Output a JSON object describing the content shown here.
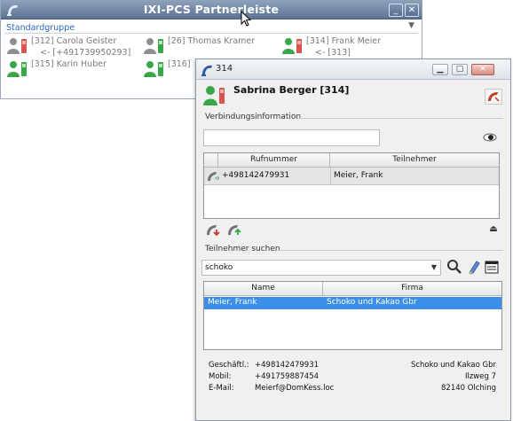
{
  "back_window": {
    "title": "IXI-PCS Partnerleiste",
    "group": "Standardgruppe",
    "partners": [
      {
        "name": "[312] Carola Geister",
        "number": "<- [+491739950293]"
      },
      {
        "name": "[26] Thomas Kramer",
        "number": ""
      },
      {
        "name": "[314] Frank Meier",
        "number": "<- [313]"
      },
      {
        "name": "[315] Karin Huber",
        "number": ""
      },
      {
        "name": "[316]",
        "number": ""
      }
    ]
  },
  "front_window": {
    "title": "314",
    "caller": "Sabrina Berger  [314]",
    "connection": {
      "section_label": "Verbindungsinformation",
      "input_value": "",
      "columns": [
        "Rufnummer",
        "Teilnehmer"
      ],
      "rows": [
        {
          "number": "+498142479931",
          "participant": "Meier, Frank"
        }
      ]
    },
    "search": {
      "section_label": "Teilnehmer suchen",
      "query": "schoko",
      "columns": [
        "Name",
        "Firma"
      ],
      "rows": [
        {
          "name": "Meier, Frank",
          "company": "Schoko und Kakao Gbr",
          "selected": true
        }
      ]
    },
    "details": {
      "business_label": "Geschäftl.:",
      "business": "+498142479931",
      "mobile_label": "Mobil:",
      "mobile": "+491759887454",
      "email_label": "E-Mail:",
      "email": "Meierf@DomKess.loc",
      "company": "Schoko und Kakao Gbr",
      "street": "Ilzweg 7",
      "city": "82140 Olching"
    }
  },
  "colors": {
    "back_titlebar": "#6b81a1",
    "group_label": "#2a68c8",
    "selection": "#3b8fe8",
    "status_green": "#3aa64a",
    "status_red": "#d9534f"
  }
}
